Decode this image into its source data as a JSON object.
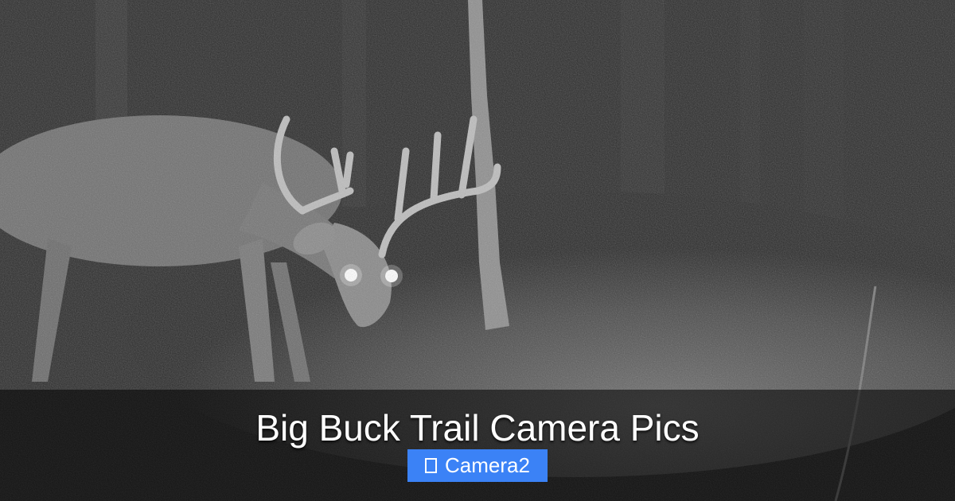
{
  "photo": {
    "subject_icon": "buck-deer-night-photo"
  },
  "banner": {
    "title": "Big Buck Trail Camera Pics",
    "tag_label": "Camera2",
    "tag_icon": "folder-icon",
    "tag_color": "#3b82f6"
  }
}
